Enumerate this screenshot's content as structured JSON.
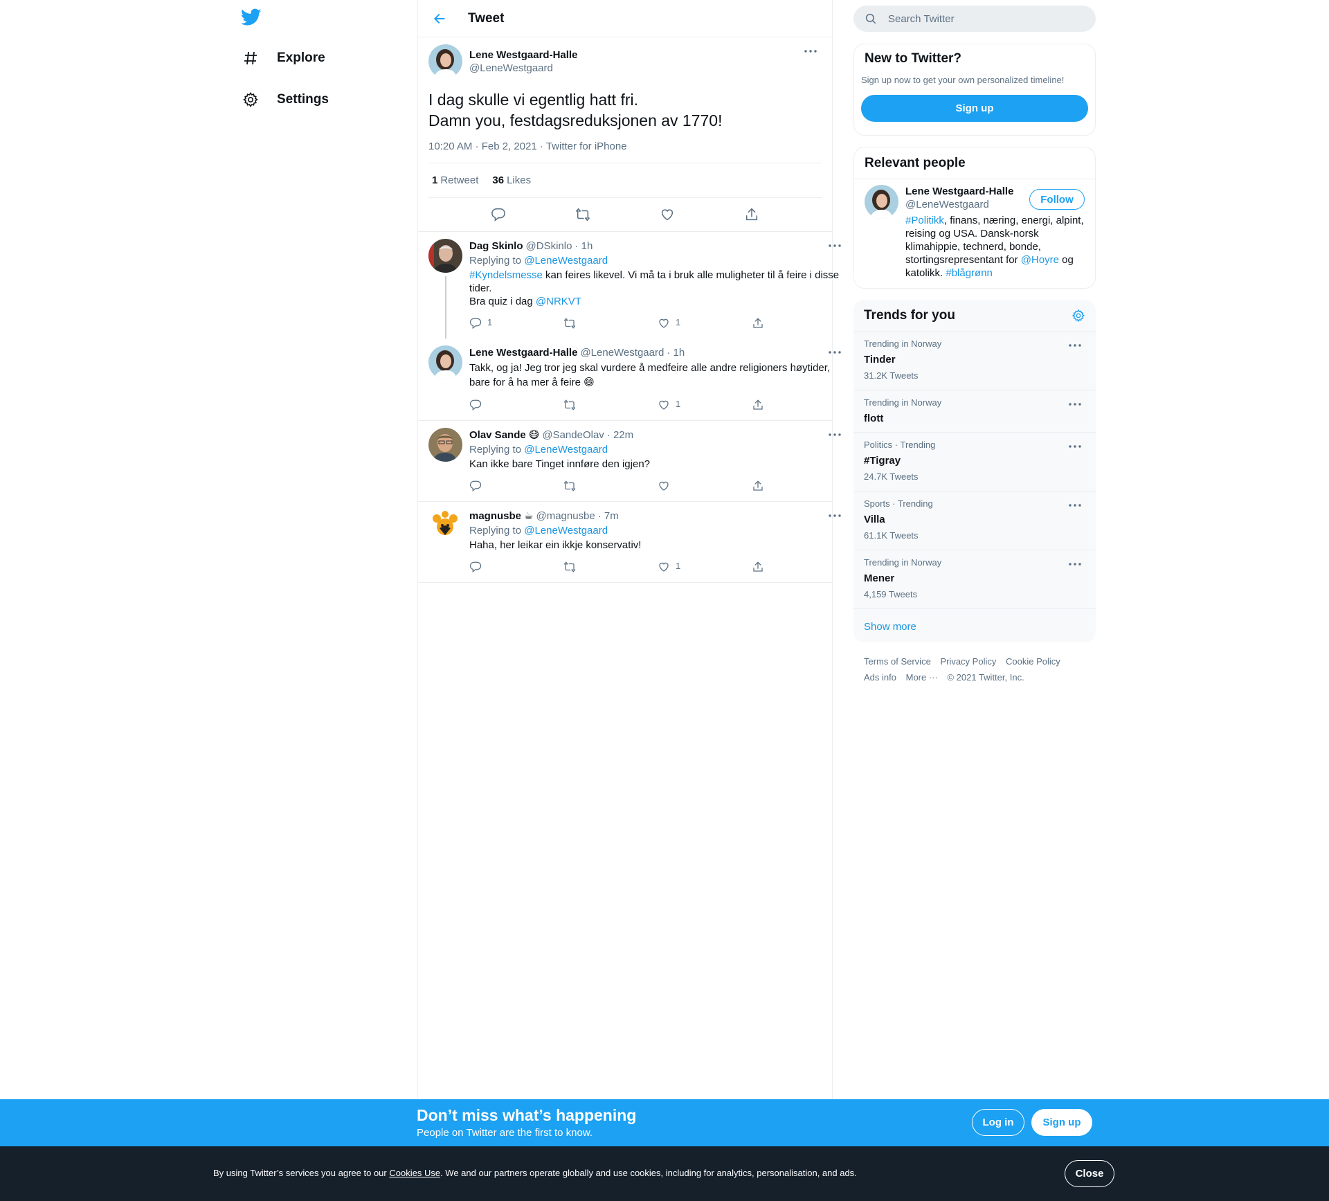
{
  "nav": {
    "explore": "Explore",
    "settings": "Settings"
  },
  "header": {
    "title": "Tweet"
  },
  "focal": {
    "name": "Lene Westgaard-Halle",
    "handle": "@LeneWestgaard",
    "line1": "I dag skulle vi egentlig hatt fri.",
    "line2": "Damn you, festdagsreduksjonen av 1770!",
    "meta": "10:20 AM · Feb 2, 2021 · Twitter for iPhone",
    "retweets_count": "1",
    "retweets_label": "Retweet",
    "likes_count": "36",
    "likes_label": "Likes"
  },
  "replies": [
    {
      "name": "Dag Skinlo",
      "handle": "@DSkinlo",
      "time": "· 1h",
      "replying": "Replying to",
      "replying_to": "@LeneWestgaard",
      "hashtag": "#Kyndelsmesse",
      "text1": " kan feires likevel. Vi må ta i bruk alle muligheter til å feire i disse tider.",
      "text2": "Bra quiz i dag ",
      "mention": "@NRKVT",
      "reply_count": "1",
      "like_count": "1"
    },
    {
      "name": "Lene Westgaard-Halle",
      "handle": "@LeneWestgaard",
      "time": "· 1h",
      "text": "Takk, og ja! Jeg tror jeg skal vurdere å medfeire alle andre religioners høytider, bare for å ha mer å feire 😄",
      "like_count": "1"
    },
    {
      "name": "Olav Sande",
      "emoji": "😷",
      "handle": "@SandeOlav",
      "time": "· 22m",
      "replying": "Replying to",
      "replying_to": "@LeneWestgaard",
      "text": "Kan ikke bare Tinget innføre den igjen?"
    },
    {
      "name": "magnusbe",
      "emoji": "☕",
      "handle": "@magnusbe",
      "time": "· 7m",
      "replying": "Replying to",
      "replying_to": "@LeneWestgaard",
      "text": "Haha, her leikar ein ikkje konservativ!",
      "like_count": "1"
    }
  ],
  "search": {
    "placeholder": "Search Twitter"
  },
  "new_to_twitter": {
    "title": "New to Twitter?",
    "subtitle": "Sign up now to get your own personalized timeline!",
    "button": "Sign up"
  },
  "relevant": {
    "title": "Relevant people",
    "name": "Lene Westgaard-Halle",
    "handle": "@LeneWestgaard",
    "follow": "Follow",
    "bio_hashtag": "#Politikk",
    "bio_text1": ", finans, næring, energi, alpint, reising og USA. Dansk-norsk klimahippie, technerd, bonde, stortingsrepresentant for ",
    "bio_mention": "@Hoyre",
    "bio_text2": " og katolikk. ",
    "bio_hashtag2": "#blågrønn"
  },
  "trends": {
    "title": "Trends for you",
    "items": [
      {
        "context": "Trending in Norway",
        "name": "Tinder",
        "count": "31.2K Tweets"
      },
      {
        "context": "Trending in Norway",
        "name": "flott",
        "count": ""
      },
      {
        "context": "Politics · Trending",
        "name": "#Tigray",
        "count": "24.7K Tweets"
      },
      {
        "context": "Sports · Trending",
        "name": "Villa",
        "count": "61.1K Tweets"
      },
      {
        "context": "Trending in Norway",
        "name": "Mener",
        "count": "4,159 Tweets"
      }
    ],
    "show_more": "Show more"
  },
  "footer": {
    "terms": "Terms of Service",
    "privacy": "Privacy Policy",
    "cookie": "Cookie Policy",
    "ads": "Ads info",
    "more": "More ···",
    "copyright": "© 2021 Twitter, Inc."
  },
  "banner": {
    "title": "Don’t miss what’s happening",
    "subtitle": "People on Twitter are the first to know.",
    "login": "Log in",
    "signup": "Sign up"
  },
  "cookie_bar": {
    "text1": "By using Twitter’s services you agree to our ",
    "link": "Cookies Use",
    "text2": ". We and our partners operate globally and use cookies, including for analytics, personalisation, and ads.",
    "close": "Close"
  },
  "colors": {
    "accent": "#1da1f2",
    "link": "#1b95e0",
    "text": "#0f1419",
    "secondary": "#5b7083",
    "cookie_bg": "#15202b"
  }
}
